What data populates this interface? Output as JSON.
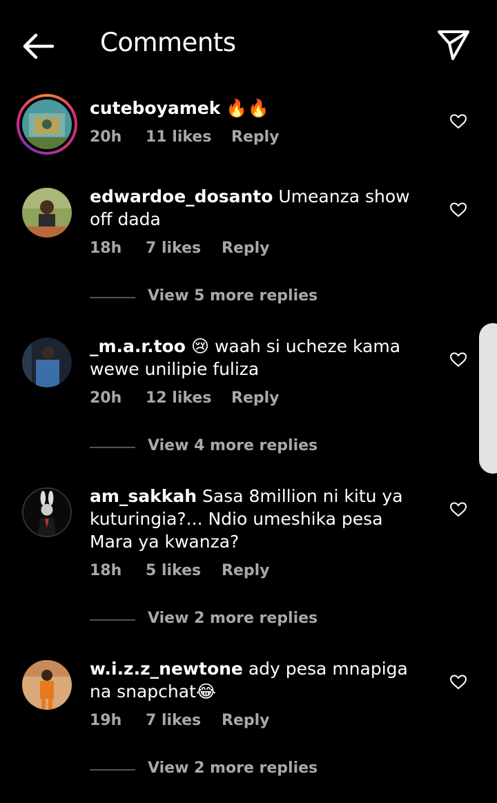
{
  "header": {
    "title": "Comments",
    "back_icon": "arrow-left-icon",
    "share_icon": "paper-plane-icon"
  },
  "comments": [
    {
      "username": "cuteboyamek",
      "text": "🔥🔥",
      "time": "20h",
      "likes": "11 likes",
      "reply": "Reply",
      "has_story_ring": true
    },
    {
      "username": "edwardoe_dosanto",
      "text": "Umeanza show off dada",
      "time": "18h",
      "likes": "7 likes",
      "reply": "Reply",
      "view_replies": "View 5 more replies"
    },
    {
      "username": "_m.a.r.too",
      "text": "😢 waah si ucheze kama wewe unilipie fuliza",
      "time": "20h",
      "likes": "12 likes",
      "reply": "Reply",
      "view_replies": "View 4 more replies"
    },
    {
      "username": "am_sakkah",
      "text": "Sasa 8million ni kitu ya kuturingia?... Ndio umeshika pesa Mara ya kwanza?",
      "time": "18h",
      "likes": "5 likes",
      "reply": "Reply",
      "view_replies": "View 2 more replies"
    },
    {
      "username": "w.i.z.z_newtone",
      "text": "ady pesa mnapiga na snapchat😂",
      "time": "19h",
      "likes": "7 likes",
      "reply": "Reply",
      "view_replies": "View 2 more replies"
    }
  ],
  "colors": {
    "background": "#000000",
    "text": "#ffffff",
    "secondary_text": "#a8a8a8"
  }
}
